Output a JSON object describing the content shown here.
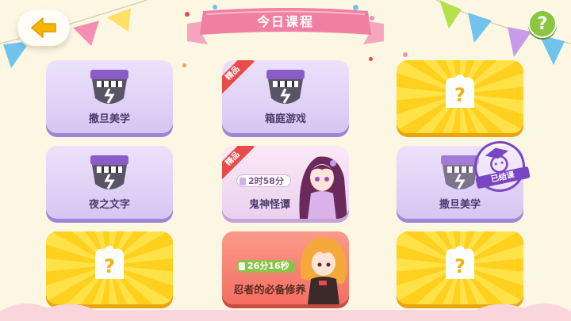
{
  "header": {
    "title": "今日课程",
    "back_icon": "arrow-left-icon",
    "help_label": "?"
  },
  "colors": {
    "background": "#fbf7e3",
    "card_purple": "#e2d6f8",
    "card_yellow": "#ffd52a",
    "card_red": "#f67f71",
    "ribbon_red": "#e94b4b",
    "stamp": "#7a45c0",
    "timer_green": "#8bc34a"
  },
  "courses": [
    {
      "label": "撒旦美学",
      "type": "badge"
    },
    {
      "label": "箱庭游戏",
      "type": "badge",
      "tag": "精品"
    },
    {
      "label": "",
      "type": "locked",
      "icon": "question-icon"
    },
    {
      "label": "夜之文字",
      "type": "badge"
    },
    {
      "label": "鬼神怪谭",
      "type": "character",
      "tag": "精品",
      "timer": "2时58分"
    },
    {
      "label": "撒旦美学",
      "type": "badge",
      "status": "已结课"
    },
    {
      "label": "",
      "type": "locked",
      "icon": "question-icon"
    },
    {
      "label": "忍者的必备修养",
      "type": "character",
      "timer": "26分16秒"
    },
    {
      "label": "",
      "type": "locked",
      "icon": "question-icon"
    }
  ]
}
